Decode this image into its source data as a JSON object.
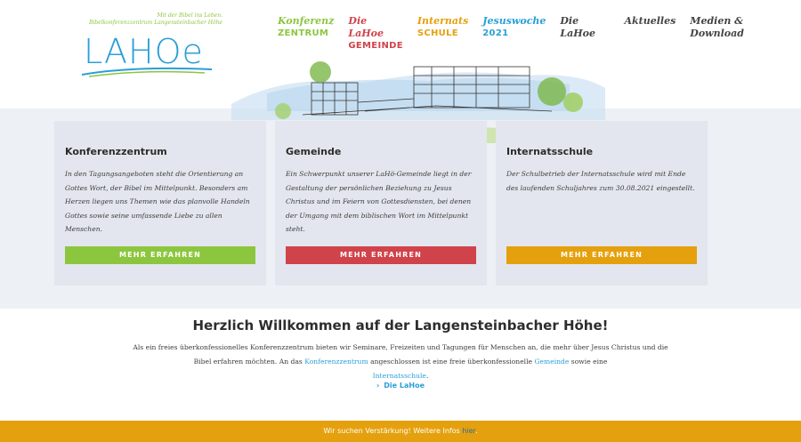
{
  "logo": {
    "tagline_line1": "Mit der Bibel ins Leben.",
    "tagline_line2": "Bibelkonferenzzentrum Langensteinbacher Höhe",
    "wordmark": "LAHOe"
  },
  "nav": {
    "items": [
      {
        "line1": "Konferenz",
        "line2": "ZENTRUM",
        "color": "#8cc63f"
      },
      {
        "line1": "Die LaHoe",
        "line2": "GEMEINDE",
        "color": "#d0434a"
      },
      {
        "line1": "Internats",
        "line2": "SCHULE",
        "color": "#e5a00d"
      },
      {
        "line1": "Jesuswoche",
        "line2": "2021",
        "color": "#2a9fd6"
      }
    ],
    "simple": [
      "Die LaHoe",
      "Aktuelles",
      "Medien & Download"
    ]
  },
  "cards": [
    {
      "title": "Konferenzzentrum",
      "text": "In den Tagungsangeboten steht die Orientierung an Gottes Wort, der Bibel im Mittelpunkt. Besonders am Herzen liegen uns Themen wie das planvolle Handeln Gottes sowie seine umfassende Liebe zu allen Menschen.",
      "button": "MEHR ERFAHREN",
      "color": "#8cc63f"
    },
    {
      "title": "Gemeinde",
      "text": "Ein Schwerpunkt unserer LaHö-Gemeinde liegt in der Gestaltung der persönlichen Beziehung zu Jesus Christus und im Feiern von Gottesdiensten, bei denen der Umgang mit dem biblischen Wort im Mittelpunkt steht.",
      "button": "MEHR ERFAHREN",
      "color": "#d0434a"
    },
    {
      "title": "Internatsschule",
      "text": "Der Schulbetrieb der Internatsschule wird mit Ende des laufenden Schuljahres zum 30.08.2021 eingestellt.",
      "button": "MEHR ERFAHREN",
      "color": "#e5a00d"
    }
  ],
  "welcome": {
    "title": "Herzlich Willkommen auf der Langensteinbacher Höhe!",
    "text_part1": "Als ein freies überkonfessionelles Konferenzzentrum bieten wir Seminare, Freizeiten und Tagungen für Menschen an, die mehr über Jesus Christus und die Bibel erfahren möchten. An das ",
    "link1": "Konferenzzentrum",
    "text_part2": " angeschlossen ist eine freie überkonfessionelle ",
    "link2": "Gemeinde",
    "text_part3": " sowie eine ",
    "link3": "Internatsschule",
    "text_part4": ".",
    "more_link": "Die LaHoe"
  },
  "footer_bar": {
    "text": "Wir suchen Verstärkung! Weitere Infos ",
    "link": "hier",
    "end": "."
  },
  "colors": {
    "green": "#8cc63f",
    "red": "#d0434a",
    "orange": "#e5a00d",
    "blue": "#2a9fd6"
  }
}
